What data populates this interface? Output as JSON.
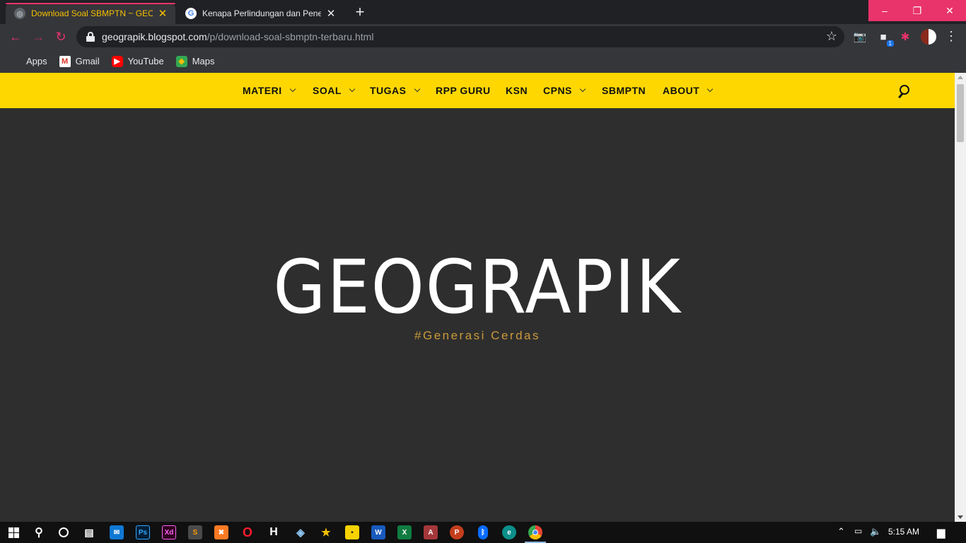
{
  "browser": {
    "tabs": [
      {
        "title": "Download Soal SBMPTN ~ GEOGRAPIK",
        "active": true
      },
      {
        "title": "Kenapa Perlindungan dan Penegakan",
        "active": false
      }
    ],
    "new_tab": "+",
    "url_host": "geograpik.blogspot.com",
    "url_path": "/p/download-soal-sbmptn-terbaru.html",
    "extension_badge": "1",
    "accent_color": "#e8336b",
    "bookmarks": [
      {
        "label": "Apps",
        "icon": "apps-grid-icon"
      },
      {
        "label": "Gmail",
        "icon": "gmail-icon"
      },
      {
        "label": "YouTube",
        "icon": "youtube-icon"
      },
      {
        "label": "Maps",
        "icon": "maps-icon"
      }
    ]
  },
  "site": {
    "nav_color": "#fed700",
    "nav": [
      {
        "label": "MATERI",
        "dropdown": true
      },
      {
        "label": "SOAL",
        "dropdown": true
      },
      {
        "label": "TUGAS",
        "dropdown": true
      },
      {
        "label": "RPP GURU",
        "dropdown": false
      },
      {
        "label": "KSN",
        "dropdown": false
      },
      {
        "label": "CPNS",
        "dropdown": true
      },
      {
        "label": "SBMPTN",
        "dropdown": false
      },
      {
        "label": "ABOUT",
        "dropdown": true
      }
    ],
    "hero_title": "GEOGRAPIK",
    "hero_tagline": "#Generasi Cerdas",
    "tagline_color": "#c99a3a"
  },
  "taskbar": {
    "clock": "5:15 AM",
    "apps": [
      "start",
      "search",
      "cortana",
      "task-view",
      "mail",
      "photoshop",
      "adobe-xd",
      "sublime-text",
      "xampp",
      "opera",
      "app-h",
      "virtualbox",
      "starred-app",
      "sticky-notes",
      "word",
      "excel",
      "access",
      "powerpoint",
      "bluetooth",
      "edge",
      "chrome"
    ]
  }
}
